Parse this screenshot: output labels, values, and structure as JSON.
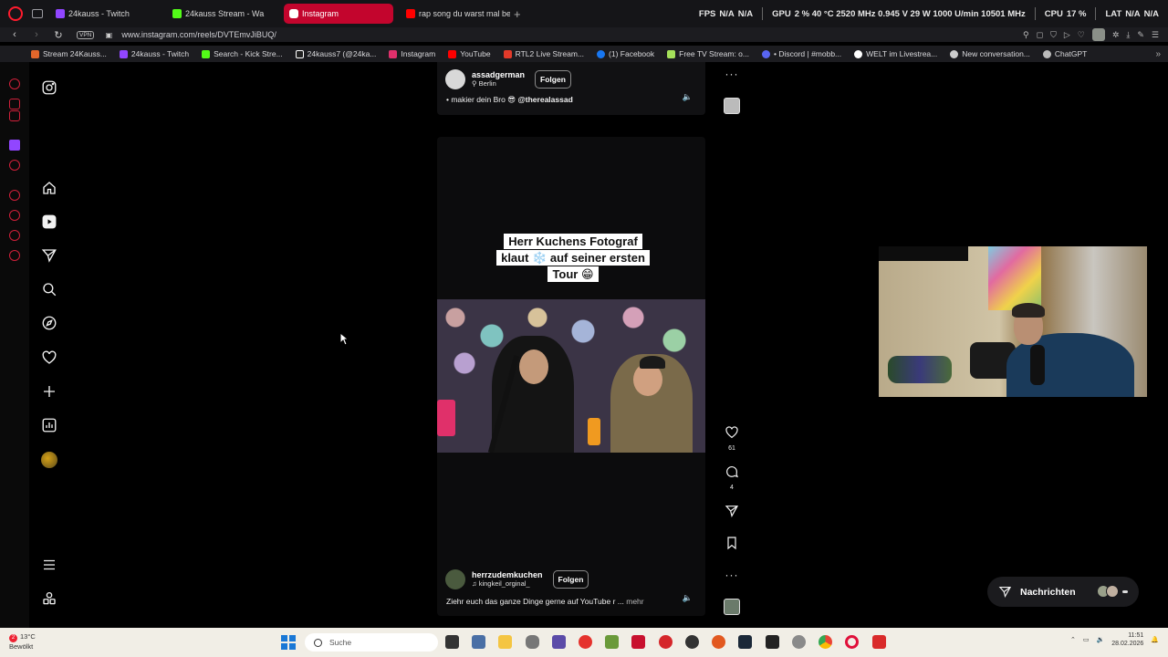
{
  "browser": {
    "tabs": [
      {
        "label": "24kauss - Twitch",
        "icon": "twitch-icon",
        "color": "#9146ff"
      },
      {
        "label": "24kauss Stream - Wa",
        "icon": "kick-icon",
        "color": "#53fc18"
      },
      {
        "label": "Instagram",
        "icon": "instagram-icon",
        "color": "#e1306c",
        "active": true
      },
      {
        "label": "rap song du warst mal bei",
        "icon": "youtube-icon",
        "color": "#ff0000"
      }
    ],
    "hud": {
      "fps_label": "FPS",
      "fps_value": "N/A",
      "fps_value2": "N/A",
      "gpu_label": "GPU",
      "gpu_stats": "2 %  40 °C  2520 MHz  0.945 V  29 W  1000 U/min  10501 MHz",
      "cpu_label": "CPU",
      "cpu_stats": "17 %",
      "lat_label": "LAT",
      "lat_value": "N/A",
      "lat_value2": "N/A"
    },
    "address": {
      "vpn": "VPN",
      "url": "www.instagram.com/reels/DVTEmvJiBUQ/"
    },
    "bookmarks": [
      {
        "label": "Stream 24Kauss...",
        "color": "#e2662b"
      },
      {
        "label": "24kauss - Twitch",
        "color": "#9146ff"
      },
      {
        "label": "Search - Kick Stre...",
        "color": "#53fc18"
      },
      {
        "label": "24kauss7 (@24ka...",
        "color": "#ffffff"
      },
      {
        "label": "Instagram",
        "color": "#e1306c"
      },
      {
        "label": "YouTube",
        "color": "#ff0000"
      },
      {
        "label": "RTL2 Live Stream...",
        "color": "#e23a2a"
      },
      {
        "label": "(1) Facebook",
        "color": "#1877f2"
      },
      {
        "label": "Free TV Stream: o...",
        "color": "#a5e05a"
      },
      {
        "label": "• Discord | #mobb...",
        "color": "#5865f2"
      },
      {
        "label": "WELT im Livestrea...",
        "color": "#ffffff"
      },
      {
        "label": "New conversation...",
        "color": "#cccccc"
      },
      {
        "label": "ChatGPT",
        "color": "#bbbbbb"
      }
    ]
  },
  "reel_top": {
    "username": "assadgerman",
    "location": "Berlin",
    "follow": "Folgen",
    "caption_prefix": "• makier dein Bro",
    "caption_emoji": "😎",
    "caption_handle": "@therealassad"
  },
  "reel": {
    "overlay_line1": "Herr Kuchens Fotograf",
    "overlay_line2": "klaut ❄️ auf seiner ersten",
    "overlay_line3": "Tour 😁",
    "username": "herrzudemkuchen",
    "audio": "kingkeil_orginal_",
    "follow": "Folgen",
    "caption": "Ziehr euch das ganze Dinge gerne auf YouTube r ...",
    "more": "mehr",
    "likes": "61",
    "comments": "4"
  },
  "messages": {
    "label": "Nachrichten"
  },
  "taskbar": {
    "weather_temp": "13°C",
    "weather_desc": "Bewölkt",
    "weather_badge": "2",
    "search": "Suche",
    "time": "11:51",
    "date": "28.02.2026"
  }
}
